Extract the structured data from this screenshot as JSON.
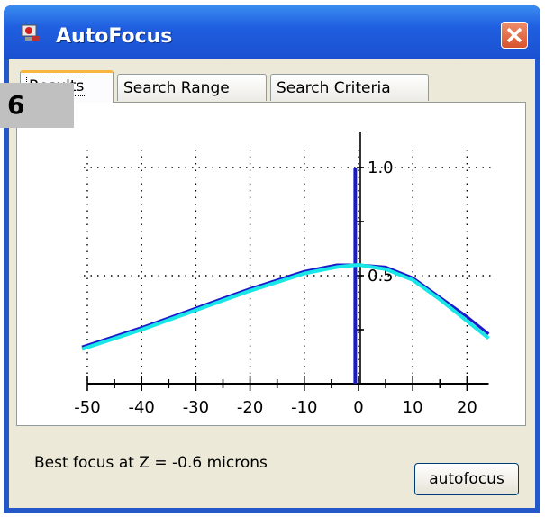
{
  "window": {
    "title": "AutoFocus",
    "icons": {
      "app": "app-icon",
      "close": "close-icon"
    }
  },
  "overlay_badge": "6",
  "tabs": [
    {
      "label": "Results",
      "active": true
    },
    {
      "label": "Search Range",
      "active": false
    },
    {
      "label": "Search Criteria",
      "active": false
    }
  ],
  "status_text": "Best focus at Z = -0.6 microns",
  "autofocus_button": "autofocus",
  "colors": {
    "curve_raw": "#1a1acc",
    "curve_fit": "#19e6e6",
    "focus_marker": "#1a1acc"
  },
  "chart_data": {
    "type": "line",
    "x_ticks": [
      "-50",
      "-40",
      "-30",
      "-20",
      "-10",
      "0",
      "10",
      "20"
    ],
    "y_ticks": [
      "0.5",
      "1.0"
    ],
    "xlim": [
      -52,
      25
    ],
    "ylim": [
      0,
      1.2
    ],
    "grid": true,
    "focus_marker_x": -0.6,
    "series": [
      {
        "x": [
          -51,
          -40,
          -30,
          -20,
          -10,
          -4,
          0,
          5,
          10,
          15,
          20,
          24
        ],
        "y": [
          0.17,
          0.26,
          0.35,
          0.44,
          0.52,
          0.55,
          0.55,
          0.54,
          0.49,
          0.4,
          0.31,
          0.23
        ]
      },
      {
        "x": [
          -51,
          -40,
          -30,
          -20,
          -10,
          -4,
          0,
          5,
          10,
          15,
          20,
          24
        ],
        "y": [
          0.16,
          0.25,
          0.34,
          0.43,
          0.51,
          0.54,
          0.55,
          0.53,
          0.48,
          0.39,
          0.29,
          0.21
        ]
      }
    ]
  }
}
